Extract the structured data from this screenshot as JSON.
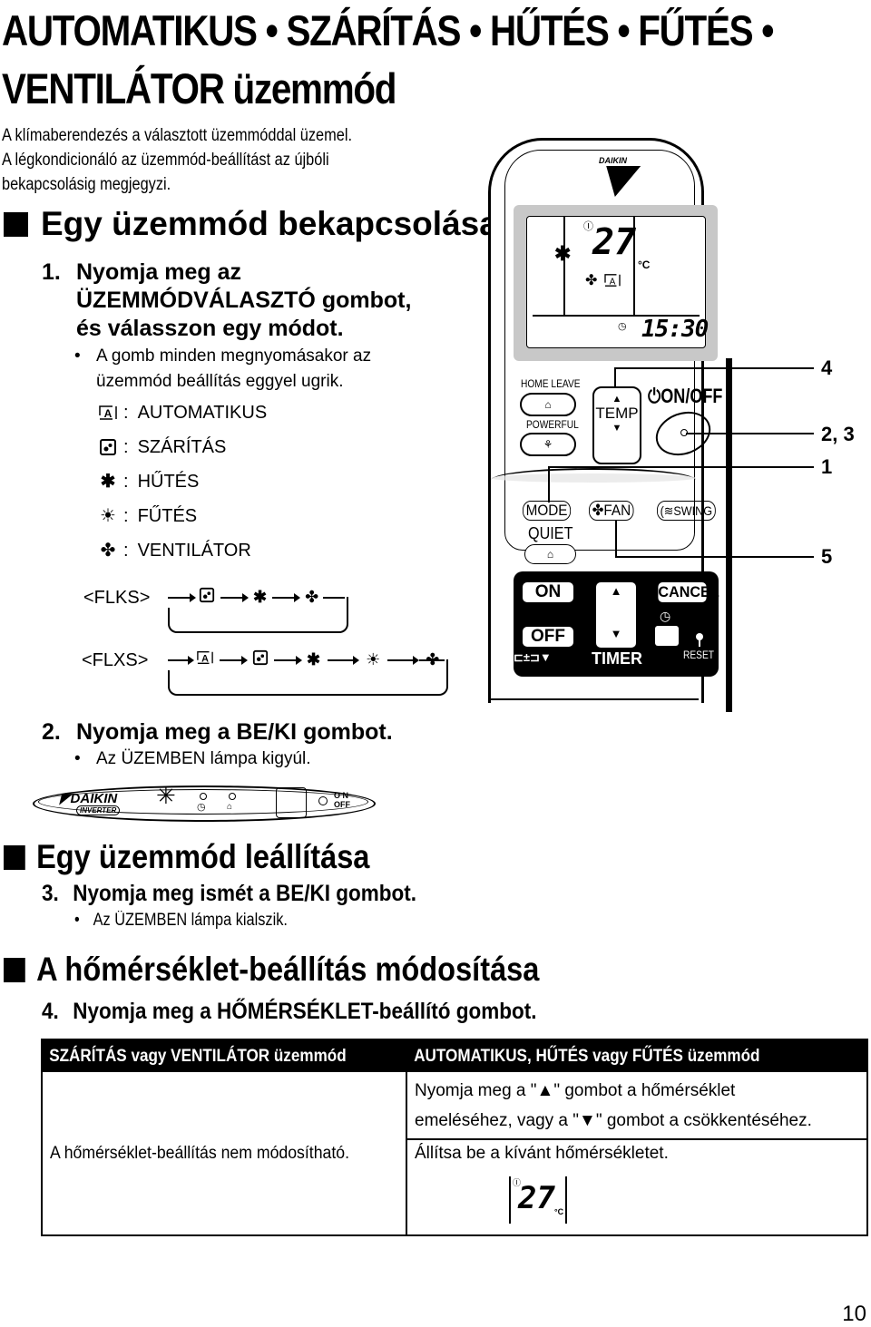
{
  "title": {
    "line1": "AUTOMATIKUS • SZÁRÍTÁS • HŰTÉS • FŰTÉS •",
    "line2": "VENTILÁTOR üzemmód"
  },
  "intro": [
    "A klímaberendezés a választott üzemmóddal üzemel.",
    "A légkondicionáló az üzemmód-beállítást az újbóli",
    "bekapcsolásig megjegyzi."
  ],
  "sections": {
    "start": {
      "heading": "Egy üzemmód bekapcsolása",
      "step1": {
        "num": "1.",
        "lines": [
          "Nyomja meg az",
          "ÜZEMMÓDVÁLASZTÓ gombot,",
          "és válasszon egy módot."
        ],
        "bullet": [
          "A gomb minden megnyomásakor az",
          "üzemmód beállítás eggyel ugrik."
        ]
      },
      "modes": [
        {
          "icon": "auto-mode-icon",
          "label": "AUTOMATIKUS"
        },
        {
          "icon": "dry-mode-icon",
          "label": "SZÁRÍTÁS"
        },
        {
          "icon": "cool-mode-icon",
          "label": "HŰTÉS"
        },
        {
          "icon": "heat-mode-icon",
          "label": "FŰTÉS"
        },
        {
          "icon": "fan-mode-icon",
          "label": "VENTILÁTOR"
        }
      ],
      "sequences": [
        {
          "label": "<FLKS>",
          "icons": [
            "dry-mode-icon",
            "cool-mode-icon",
            "fan-mode-icon"
          ]
        },
        {
          "label": "<FLXS>",
          "icons": [
            "auto-mode-icon",
            "dry-mode-icon",
            "cool-mode-icon",
            "heat-mode-icon",
            "fan-mode-icon"
          ]
        }
      ],
      "step2": {
        "num": "2.",
        "text": "Nyomja meg a BE/KI gombot.",
        "bullet": "Az ÜZEMBEN lámpa kigyúl."
      },
      "indoor_panel": {
        "brand": "DAIKIN",
        "sub": "INVERTER",
        "onoff_on": "O N",
        "onoff_off": "OFF"
      }
    },
    "stop": {
      "heading": "Egy üzemmód leállítása",
      "step3": {
        "num": "3.",
        "text": "Nyomja meg ismét a BE/KI gombot.",
        "bullet": "Az ÜZEMBEN lámpa kialszik."
      }
    },
    "temp": {
      "heading": "A hőmérséklet-beállítás módosítása",
      "step4": {
        "num": "4.",
        "text": "Nyomja meg a HŐMÉRSÉKLET-beállító gombot."
      },
      "table": {
        "col1_header": "SZÁRÍTÁS vagy VENTILÁTOR üzemmód",
        "col2_header": "AUTOMATIKUS, HŰTÉS vagy FŰTÉS üzemmód",
        "col1_text": "A hőmérséklet-beállítás nem módosítható.",
        "col2_line1_a": "Nyomja meg a \"",
        "col2_line1_b": "\" gombot a hőmérséklet",
        "col2_line2_a": "emeléséhez, vagy a \"",
        "col2_line2_b": "\" gombot a csökkentéséhez.",
        "col2_line3": "Állítsa be a kívánt hőmérsékletet.",
        "display_temp": "27",
        "display_unit": "°C"
      }
    }
  },
  "remote": {
    "brand": "DAIKIN",
    "lcd": {
      "temp": "27",
      "unit": "°C",
      "clock": "15:30"
    },
    "buttons": {
      "home_leave": "HOME LEAVE",
      "powerful": "POWERFUL",
      "temp": "TEMP",
      "onoff": "ON/OFF",
      "mode": "MODE",
      "fan": "FAN",
      "swing": "SWING",
      "quiet": "QUIET",
      "timer_on": "ON",
      "timer_off": "OFF",
      "timer": "TIMER",
      "cancel": "CANCEL",
      "reset": "RESET"
    },
    "callouts": {
      "c4": "4",
      "c23": "2, 3",
      "c1": "1",
      "c5": "5"
    }
  },
  "page_number": "10"
}
